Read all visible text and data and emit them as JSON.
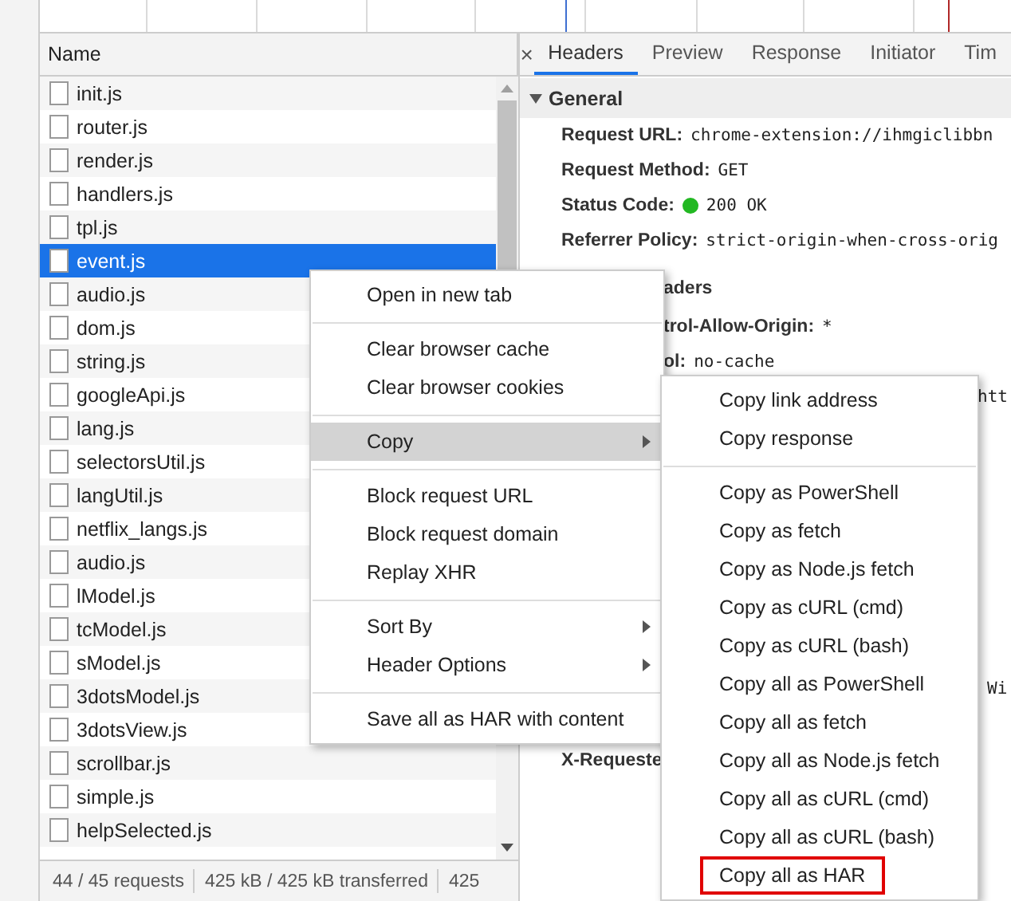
{
  "requests": {
    "column": "Name",
    "rows": [
      {
        "name": "init.js",
        "selected": false
      },
      {
        "name": "router.js",
        "selected": false
      },
      {
        "name": "render.js",
        "selected": false
      },
      {
        "name": "handlers.js",
        "selected": false
      },
      {
        "name": "tpl.js",
        "selected": false
      },
      {
        "name": "event.js",
        "selected": true
      },
      {
        "name": "audio.js",
        "selected": false
      },
      {
        "name": "dom.js",
        "selected": false
      },
      {
        "name": "string.js",
        "selected": false
      },
      {
        "name": "googleApi.js",
        "selected": false
      },
      {
        "name": "lang.js",
        "selected": false
      },
      {
        "name": "selectorsUtil.js",
        "selected": false
      },
      {
        "name": "langUtil.js",
        "selected": false
      },
      {
        "name": "netflix_langs.js",
        "selected": false
      },
      {
        "name": "audio.js",
        "selected": false
      },
      {
        "name": "lModel.js",
        "selected": false
      },
      {
        "name": "tcModel.js",
        "selected": false
      },
      {
        "name": "sModel.js",
        "selected": false
      },
      {
        "name": "3dotsModel.js",
        "selected": false
      },
      {
        "name": "3dotsView.js",
        "selected": false
      },
      {
        "name": "scrollbar.js",
        "selected": false
      },
      {
        "name": "simple.js",
        "selected": false
      },
      {
        "name": "helpSelected.js",
        "selected": false
      }
    ]
  },
  "status_bar": [
    "44 / 45 requests",
    "425 kB / 425 kB transferred",
    "425"
  ],
  "details": {
    "close": "×",
    "tabs": [
      {
        "label": "Headers",
        "selected": true
      },
      {
        "label": "Preview",
        "selected": false
      },
      {
        "label": "Response",
        "selected": false
      },
      {
        "label": "Initiator",
        "selected": false
      },
      {
        "label": "Tim",
        "selected": false
      }
    ],
    "section": {
      "title": "General",
      "expanded": true
    },
    "fields": [
      {
        "label": "Request URL:",
        "value": "chrome-extension://ihmgiclibbn"
      },
      {
        "label": "Request Method:",
        "value": "GET"
      },
      {
        "label": "Status Code:",
        "value": "200 OK",
        "color": "#22b822"
      },
      {
        "label": "Referrer Policy:",
        "value": "strict-origin-when-cross-orig"
      }
    ],
    "covered_fragments": [
      {
        "label": "aders"
      },
      {
        "label": "trol-Allow-Origin:",
        "value": "*"
      },
      {
        "label": "ol:",
        "value": "no-cache"
      },
      {
        "value": "htt"
      },
      {
        "value": "Wi"
      },
      {
        "label": "X-Requeste"
      }
    ]
  },
  "context_menu": {
    "groups": [
      [
        {
          "label": "Open in new tab",
          "hovered": false,
          "submenu": false
        }
      ],
      [
        {
          "label": "Clear browser cache",
          "hovered": false,
          "submenu": false
        },
        {
          "label": "Clear browser cookies",
          "hovered": false,
          "submenu": false
        }
      ],
      [
        {
          "label": "Copy",
          "hovered": true,
          "submenu": true
        }
      ],
      [
        {
          "label": "Block request URL",
          "hovered": false,
          "submenu": false
        },
        {
          "label": "Block request domain",
          "hovered": false,
          "submenu": false
        },
        {
          "label": "Replay XHR",
          "hovered": false,
          "submenu": false
        }
      ],
      [
        {
          "label": "Sort By",
          "hovered": false,
          "submenu": true
        },
        {
          "label": "Header Options",
          "hovered": false,
          "submenu": true
        }
      ],
      [
        {
          "label": "Save all as HAR with content",
          "hovered": false,
          "submenu": false
        }
      ]
    ]
  },
  "copy_submenu": {
    "groups": [
      [
        {
          "label": "Copy link address",
          "outlined": false
        },
        {
          "label": "Copy response",
          "outlined": false
        }
      ],
      [
        {
          "label": "Copy as PowerShell",
          "outlined": false
        },
        {
          "label": "Copy as fetch",
          "outlined": false
        },
        {
          "label": "Copy as Node.js fetch",
          "outlined": false
        },
        {
          "label": "Copy as cURL (cmd)",
          "outlined": false
        },
        {
          "label": "Copy as cURL (bash)",
          "outlined": false
        },
        {
          "label": "Copy all as PowerShell",
          "outlined": false
        },
        {
          "label": "Copy all as fetch",
          "outlined": false
        },
        {
          "label": "Copy all as Node.js fetch",
          "outlined": false
        },
        {
          "label": "Copy all as cURL (cmd)",
          "outlined": false
        },
        {
          "label": "Copy all as cURL (bash)",
          "outlined": false
        },
        {
          "label": "Copy all as HAR",
          "outlined": true
        }
      ]
    ]
  }
}
